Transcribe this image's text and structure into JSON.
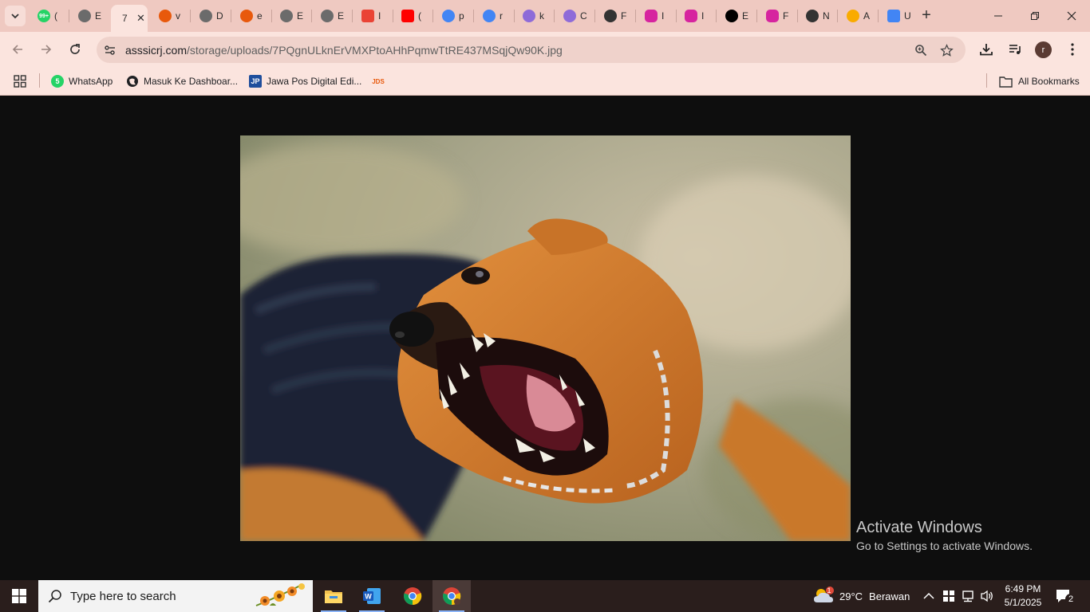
{
  "browser": {
    "tabs": [
      {
        "title": "(",
        "icon": "whatsapp-icon",
        "color": "#25d366",
        "badge": "99+"
      },
      {
        "title": "E",
        "icon": "globe-icon",
        "color": "#6b6b6b"
      },
      {
        "title": "7",
        "icon": "none",
        "color": "#000000",
        "active": true
      },
      {
        "title": "v",
        "icon": "flame-icon",
        "color": "#e8590c"
      },
      {
        "title": "D",
        "icon": "globe-icon",
        "color": "#6b6b6b"
      },
      {
        "title": "e",
        "icon": "flame-icon",
        "color": "#e8590c"
      },
      {
        "title": "E",
        "icon": "globe-icon",
        "color": "#6b6b6b"
      },
      {
        "title": "E",
        "icon": "globe-icon",
        "color": "#6b6b6b"
      },
      {
        "title": "I",
        "icon": "gmail-icon",
        "color": "#ea4335"
      },
      {
        "title": "(",
        "icon": "youtube-icon",
        "color": "#ff0000"
      },
      {
        "title": "p",
        "icon": "google-icon",
        "color": "#4285f4"
      },
      {
        "title": "r",
        "icon": "google-icon",
        "color": "#4285f4"
      },
      {
        "title": "k",
        "icon": "gemini-icon",
        "color": "#8e6bd8"
      },
      {
        "title": "C",
        "icon": "gemini-icon",
        "color": "#8e6bd8"
      },
      {
        "title": "F",
        "icon": "x-icon",
        "color": "#333333"
      },
      {
        "title": "I",
        "icon": "instagram-icon",
        "color": "#d6249f"
      },
      {
        "title": "I",
        "icon": "instagram-icon",
        "color": "#d6249f"
      },
      {
        "title": "E",
        "icon": "threads-icon",
        "color": "#000000"
      },
      {
        "title": "F",
        "icon": "instagram-icon",
        "color": "#d6249f"
      },
      {
        "title": "N",
        "icon": "x-icon",
        "color": "#333333"
      },
      {
        "title": "A",
        "icon": "colab-icon",
        "color": "#f9ab00"
      },
      {
        "title": "U",
        "icon": "docs-icon",
        "color": "#4285f4"
      }
    ],
    "url_host": "asssicrj.com",
    "url_path": "/storage/uploads/7PQgnULknErVMXPtoAHhPqmwTtRE437MSqjQw90K.jpg",
    "profile_initial": "r",
    "bookmarks": [
      {
        "label": "WhatsApp",
        "icon": "whatsapp-icon",
        "color": "#25d366"
      },
      {
        "label": "Masuk Ke Dashboar...",
        "icon": "globe-icon",
        "color": "#202124"
      },
      {
        "label": "Jawa Pos Digital Edi...",
        "icon": "jawapos-icon",
        "color": "#1f4e9c"
      },
      {
        "label": "",
        "icon": "jds-icon",
        "color": "#e8590c"
      }
    ],
    "all_bookmarks_label": "All Bookmarks"
  },
  "content": {
    "image_alt": "Snarling dog",
    "watermark_title": "Activate Windows",
    "watermark_subtitle": "Go to Settings to activate Windows."
  },
  "taskbar": {
    "search_placeholder": "Type here to search",
    "weather_temp": "29°C",
    "weather_desc": "Berawan",
    "weather_badge": "1",
    "time": "6:49 PM",
    "date": "5/1/2025",
    "notification_count": "2"
  }
}
